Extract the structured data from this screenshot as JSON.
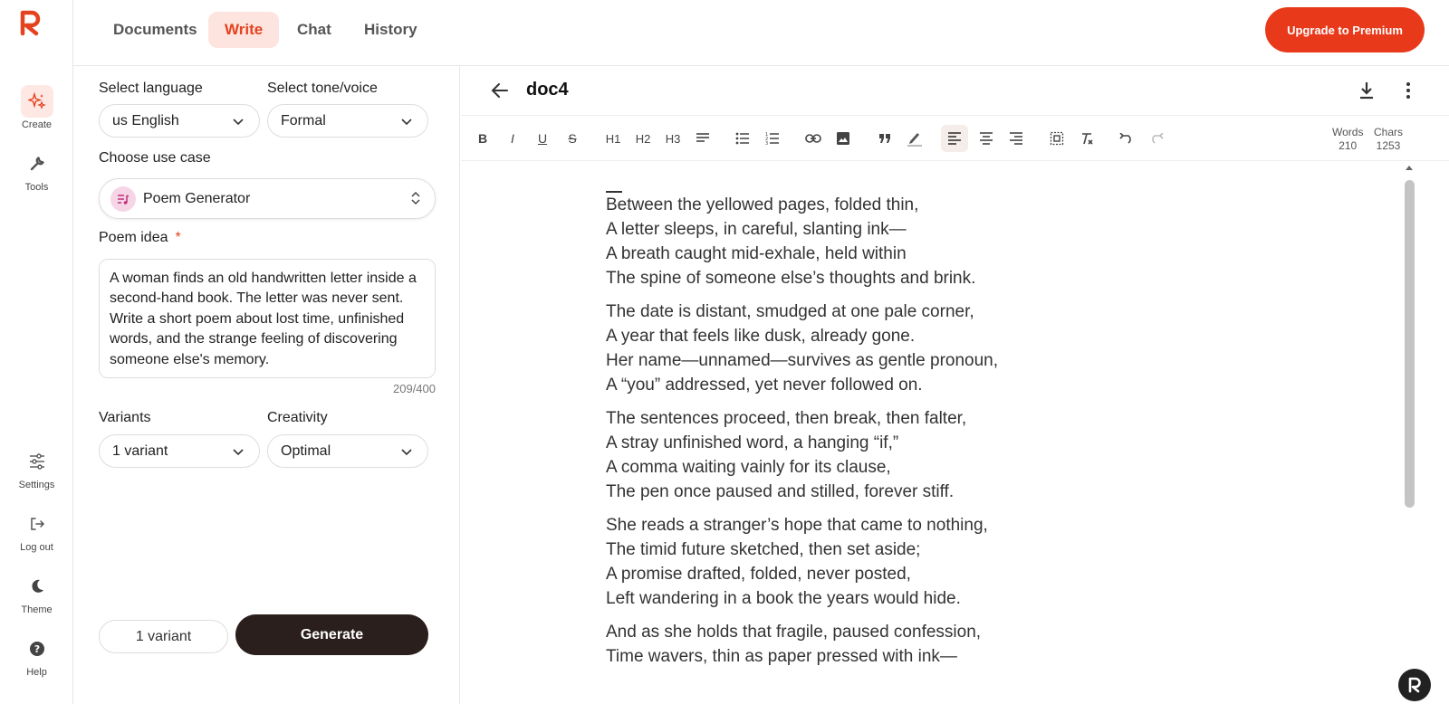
{
  "rail": {
    "items": [
      {
        "label": "Create"
      },
      {
        "label": "Tools"
      },
      {
        "label": "Settings"
      },
      {
        "label": "Log out"
      },
      {
        "label": "Theme"
      },
      {
        "label": "Help"
      }
    ]
  },
  "nav": {
    "tabs": [
      {
        "label": "Documents"
      },
      {
        "label": "Write"
      },
      {
        "label": "Chat"
      },
      {
        "label": "History"
      }
    ],
    "active_tab": "Write",
    "upgrade_label": "Upgrade to Premium"
  },
  "form": {
    "language_label": "Select language",
    "language_value": "us English",
    "tone_label": "Select tone/voice",
    "tone_value": "Formal",
    "usecase_label": "Choose use case",
    "usecase_value": "Poem Generator",
    "idea_label": "Poem idea",
    "idea_required": "*",
    "idea_value": "A woman finds an old handwritten letter inside a second-hand book. The letter was never sent. Write a short poem about lost time, unfinished words, and the strange feeling of discovering someone else's memory.",
    "idea_counter": "209/400",
    "variants_label": "Variants",
    "variants_value": "1 variant",
    "creativity_label": "Creativity",
    "creativity_value": "Optimal",
    "footer_variants": "1 variant",
    "generate_label": "Generate"
  },
  "editor": {
    "title": "doc4",
    "toolbar": {
      "h1": "H1",
      "h2": "H2",
      "h3": "H3",
      "bold": "B",
      "italic": "I",
      "underline": "U",
      "strike": "S"
    },
    "words_label": "Words",
    "words_value": "210",
    "chars_label": "Chars",
    "chars_value": "1253",
    "stanzas": [
      [
        "Between the yellowed pages, folded thin,",
        "A letter sleeps, in careful, slanting ink—",
        "A breath caught mid-exhale, held within",
        "The spine of someone else’s thoughts and brink."
      ],
      [
        "The date is distant, smudged at one pale corner,",
        "A year that feels like dusk, already gone.",
        "Her name—unnamed—survives as gentle pronoun,",
        "A “you” addressed, yet never followed on."
      ],
      [
        "The sentences proceed, then break, then falter,",
        "A stray unfinished word, a hanging “if,”",
        "A comma waiting vainly for its clause,",
        "The pen once paused and stilled, forever stiff."
      ],
      [
        "She reads a stranger’s hope that came to nothing,",
        "The timid future sketched, then set aside;",
        "A promise drafted, folded, never posted,",
        "Left wandering in a book the years would hide."
      ],
      [
        "And as she holds that fragile, paused confession,",
        "Time wavers, thin as paper pressed with ink—"
      ]
    ]
  },
  "colors": {
    "accent": "#e8391a",
    "accent_soft": "#fde4de",
    "dark_button": "#2a1f1c"
  }
}
